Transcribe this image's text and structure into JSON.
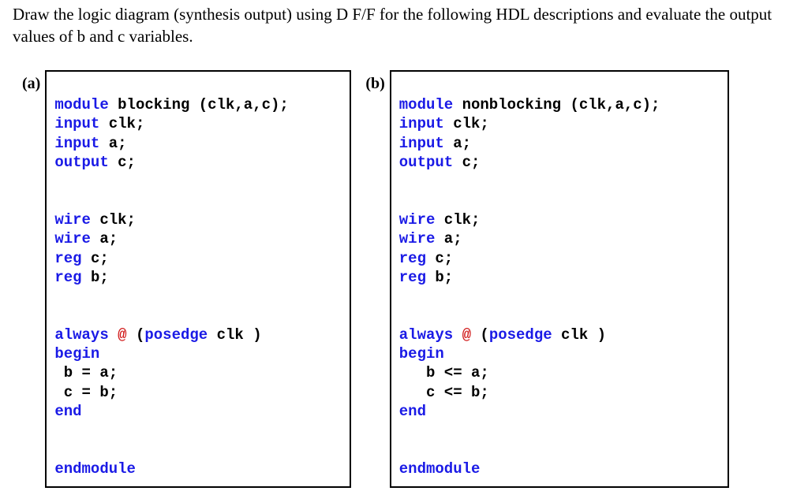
{
  "instruction": "Draw the logic diagram (synthesis output) using D F/F for the following HDL descriptions and evaluate the output values of b and c variables.",
  "labels": {
    "a": "(a)",
    "b": "(b)"
  },
  "codeA": {
    "l1_kw": "module",
    "l1_name": " blocking ",
    "l1_args": "(clk,a,c);",
    "l2_kw": "input",
    "l2_rest": " clk;",
    "l3_kw": "input",
    "l3_rest": " a;",
    "l4_kw": "output",
    "l4_rest": " c;",
    "l5_kw": "wire",
    "l5_rest": " clk;",
    "l6_kw": "wire",
    "l6_rest": " a;",
    "l7_kw": "reg",
    "l7_rest": " c;",
    "l8_kw": "reg",
    "l8_rest": " b;",
    "l9_kw": "always",
    "l9_at": " @ ",
    "l9_paren_o": "(",
    "l9_edge": "posedge",
    "l9_rest": " clk )",
    "l10_kw": "begin",
    "l11": " b = a;",
    "l12": " c = b;",
    "l13_kw": "end",
    "l14_kw": "endmodule"
  },
  "codeB": {
    "l1_kw": "module",
    "l1_name": " nonblocking ",
    "l1_args": "(clk,a,c);",
    "l2_kw": "input",
    "l2_rest": " clk;",
    "l3_kw": "input",
    "l3_rest": " a;",
    "l4_kw": "output",
    "l4_rest": " c;",
    "l5_kw": "wire",
    "l5_rest": " clk;",
    "l6_kw": "wire",
    "l6_rest": " a;",
    "l7_kw": "reg",
    "l7_rest": " c;",
    "l8_kw": "reg",
    "l8_rest": " b;",
    "l9_kw": "always",
    "l9_at": " @ ",
    "l9_paren_o": "(",
    "l9_edge": "posedge",
    "l9_rest": " clk )",
    "l10_kw": "begin",
    "l11": "   b <= a;",
    "l12": "   c <= b;",
    "l13_kw": "end",
    "l14_kw": "endmodule"
  }
}
